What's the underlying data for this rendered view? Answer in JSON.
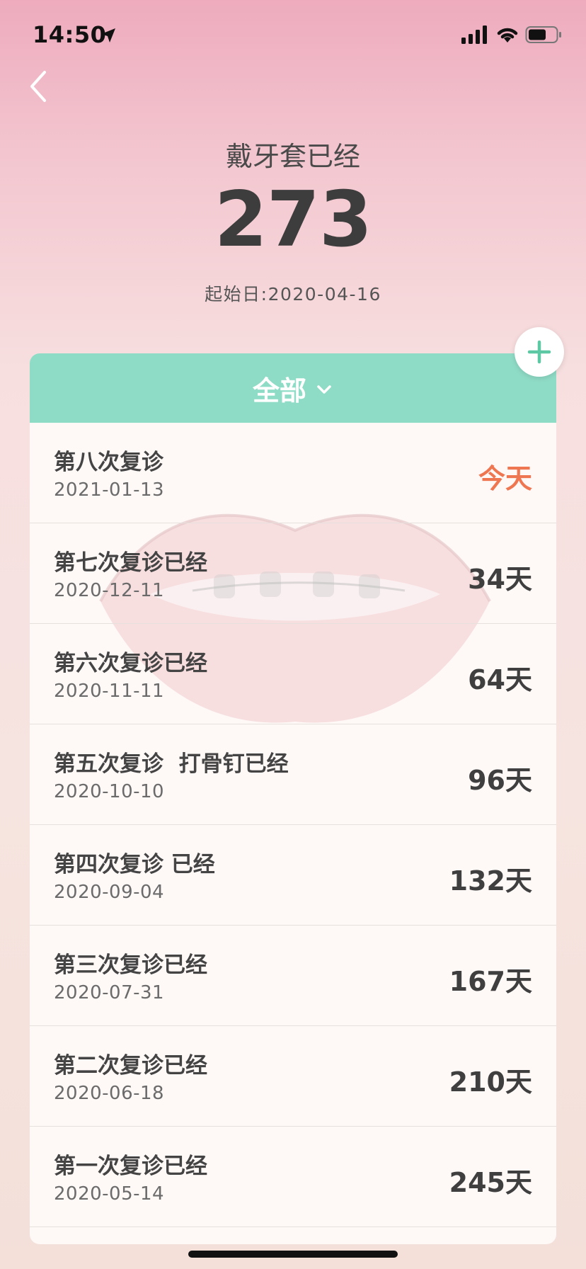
{
  "status": {
    "time": "14:50"
  },
  "header": {
    "title": "戴牙套已经",
    "count": "273",
    "start_date": "起始日:2020-04-16"
  },
  "filter": {
    "label": "全部"
  },
  "items": [
    {
      "title": "第八次复诊",
      "date": "2021-01-13",
      "days": "今天"
    },
    {
      "title": "第七次复诊已经",
      "date": "2020-12-11",
      "days": "34天"
    },
    {
      "title": "第六次复诊已经",
      "date": "2020-11-11",
      "days": "64天"
    },
    {
      "title": "第五次复诊  打骨钉已经",
      "date": "2020-10-10",
      "days": "96天"
    },
    {
      "title": "第四次复诊 已经",
      "date": "2020-09-04",
      "days": "132天"
    },
    {
      "title": "第三次复诊已经",
      "date": "2020-07-31",
      "days": "167天"
    },
    {
      "title": "第二次复诊已经",
      "date": "2020-06-18",
      "days": "210天"
    },
    {
      "title": "第一次复诊已经",
      "date": "2020-05-14",
      "days": "245天"
    }
  ],
  "colors": {
    "accent": "#8fdcc6",
    "today": "#ee7650",
    "add_icon": "#5cc8a4"
  }
}
